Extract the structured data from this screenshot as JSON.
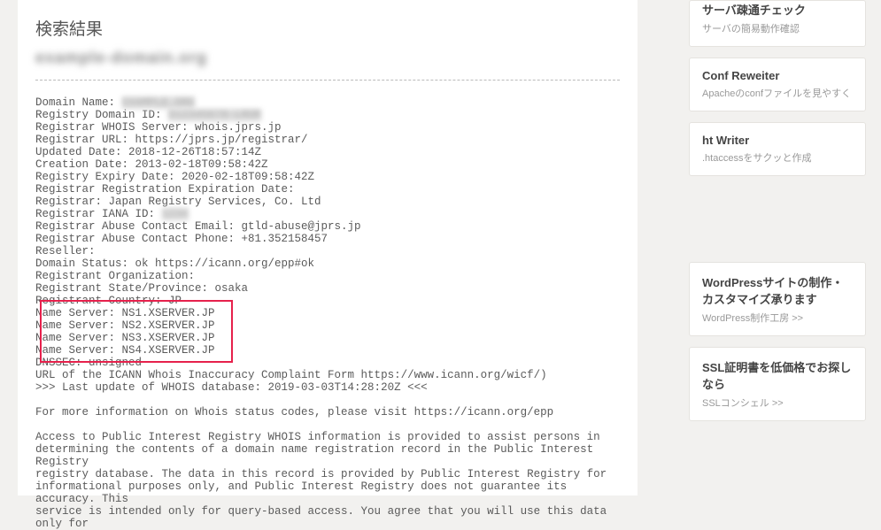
{
  "page": {
    "title": "検索結果",
    "domain_blurred": "example-domain.org"
  },
  "whois": {
    "line_domain_name": "Domain Name: ",
    "line_registry_id": "Registry Domain ID: ",
    "line_whois_server": "Registrar WHOIS Server: whois.jprs.jp",
    "line_registrar_url": "Registrar URL: https://jprs.jp/registrar/",
    "line_updated": "Updated Date: 2018-12-26T18:57:14Z",
    "line_creation": "Creation Date: 2013-02-18T09:58:42Z",
    "line_expiry": "Registry Expiry Date: 2020-02-18T09:58:42Z",
    "line_reg_exp": "Registrar Registration Expiration Date:",
    "line_registrar": "Registrar: Japan Registry Services, Co. Ltd",
    "line_iana": "Registrar IANA ID: ",
    "line_abuse_email": "Registrar Abuse Contact Email: gtld-abuse@jprs.jp",
    "line_abuse_phone": "Registrar Abuse Contact Phone: +81.352158457",
    "line_reseller": "Reseller:",
    "line_status": "Domain Status: ok https://icann.org/epp#ok",
    "line_org": "Registrant Organization:",
    "line_state": "Registrant State/Province: osaka",
    "line_country": "Registrant Country: JP",
    "line_ns1": "Name Server: NS1.XSERVER.JP",
    "line_ns2": "Name Server: NS2.XSERVER.JP",
    "line_ns3": "Name Server: NS3.XSERVER.JP",
    "line_ns4": "Name Server: NS4.XSERVER.JP",
    "line_dnssec": "DNSSEC: unsigned",
    "line_icann_url": "URL of the ICANN Whois Inaccuracy Complaint Form https://www.icann.org/wicf/)",
    "line_last_update": ">>> Last update of WHOIS database: 2019-03-03T14:28:20Z <<<",
    "line_more_info": "For more information on Whois status codes, please visit https://icann.org/epp",
    "line_access1": "Access to Public Interest Registry WHOIS information is provided to assist persons in",
    "line_access2": "determining the contents of a domain name registration record in the Public Interest Registry",
    "line_access3": "registry database. The data in this record is provided by Public Interest Registry for",
    "line_access4": "informational purposes only, and Public Interest Registry does not guarantee its accuracy. This",
    "line_access5": "service is intended only for query-based access. You agree that you will use this data only for",
    "blur_domain": "EXAMPLE.ORG",
    "blur_regid": "D12345678-LROR",
    "blur_iana": "1234"
  },
  "sidebar": {
    "card0_title": "サーバ疎通チェック",
    "card0_desc": "サーバの簡易動作確認",
    "card1_title": "Conf Reweiter",
    "card1_desc": "Apacheのconfファイルを見やすく",
    "card2_title": "ht Writer",
    "card2_desc": ".htaccessをサクッと作成",
    "card3_title": "WordPressサイトの制作・カスタマイズ承ります",
    "card3_desc": "WordPress制作工房 >>",
    "card4_title": "SSL証明書を低価格でお探しなら",
    "card4_desc": "SSLコンシェル >>"
  }
}
